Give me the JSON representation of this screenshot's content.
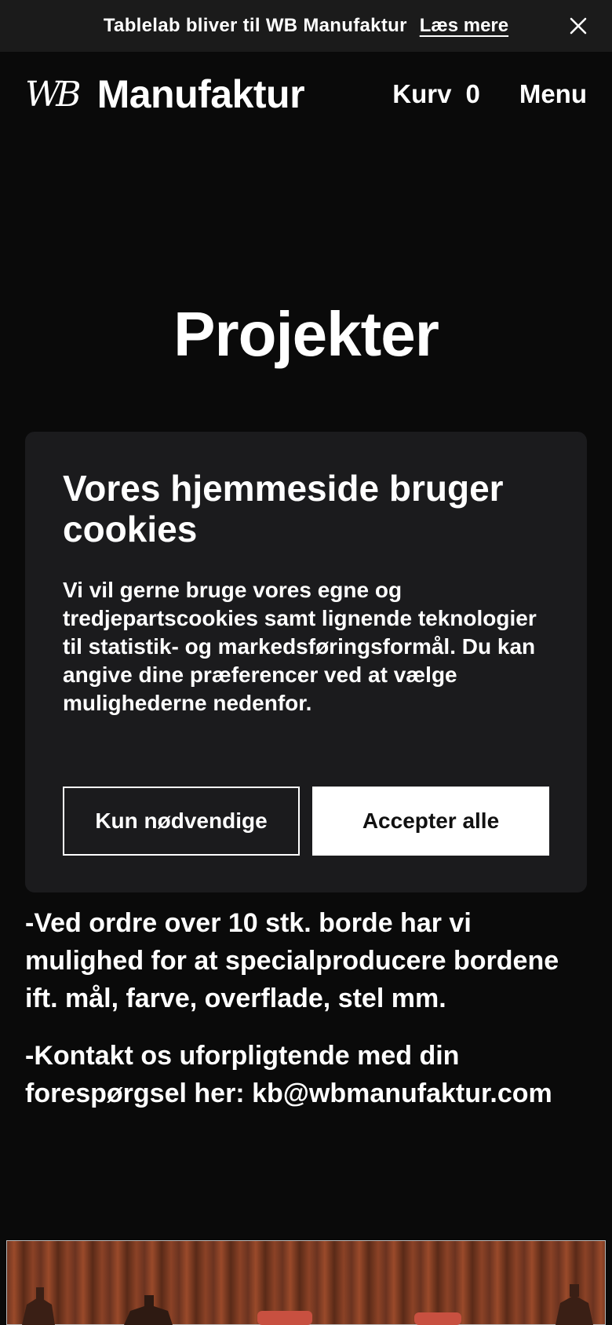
{
  "announcement": {
    "message": "Tablelab bliver til WB Manufaktur",
    "link": "Læs mere"
  },
  "header": {
    "logo_monogram": "WB",
    "logo_text": "Manufaktur",
    "cart_label": "Kurv",
    "cart_count": "0",
    "menu_label": "Menu"
  },
  "page": {
    "title": "Projekter"
  },
  "cookie_banner": {
    "title": "Vores hjemmeside bruger cookies",
    "text": "Vi vil gerne bruge vores egne og tredjepartscookies samt lignende teknologier til statistik- og markedsføringsformål. Du kan angive dine præferencer ved at vælge mulighederne nedenfor.",
    "necessary_label": "Kun nødvendige",
    "accept_label": "Accepter alle"
  },
  "content": {
    "paragraphs": [
      "-Ved ordre over 10 stk. borde har vi mulighed for at specialproducere bordene ift. mål, farve, overflade, stel mm.",
      "-Kontakt os uforpligtende med din forespørgsel her: kb@wbmanufaktur.com"
    ]
  },
  "colors": {
    "background": "#0a0a0a",
    "announcement_bar": "#1b1b1b",
    "cookie_panel": "#1b1b1d",
    "text": "#ffffff"
  },
  "icons": {
    "close": "close-icon"
  }
}
